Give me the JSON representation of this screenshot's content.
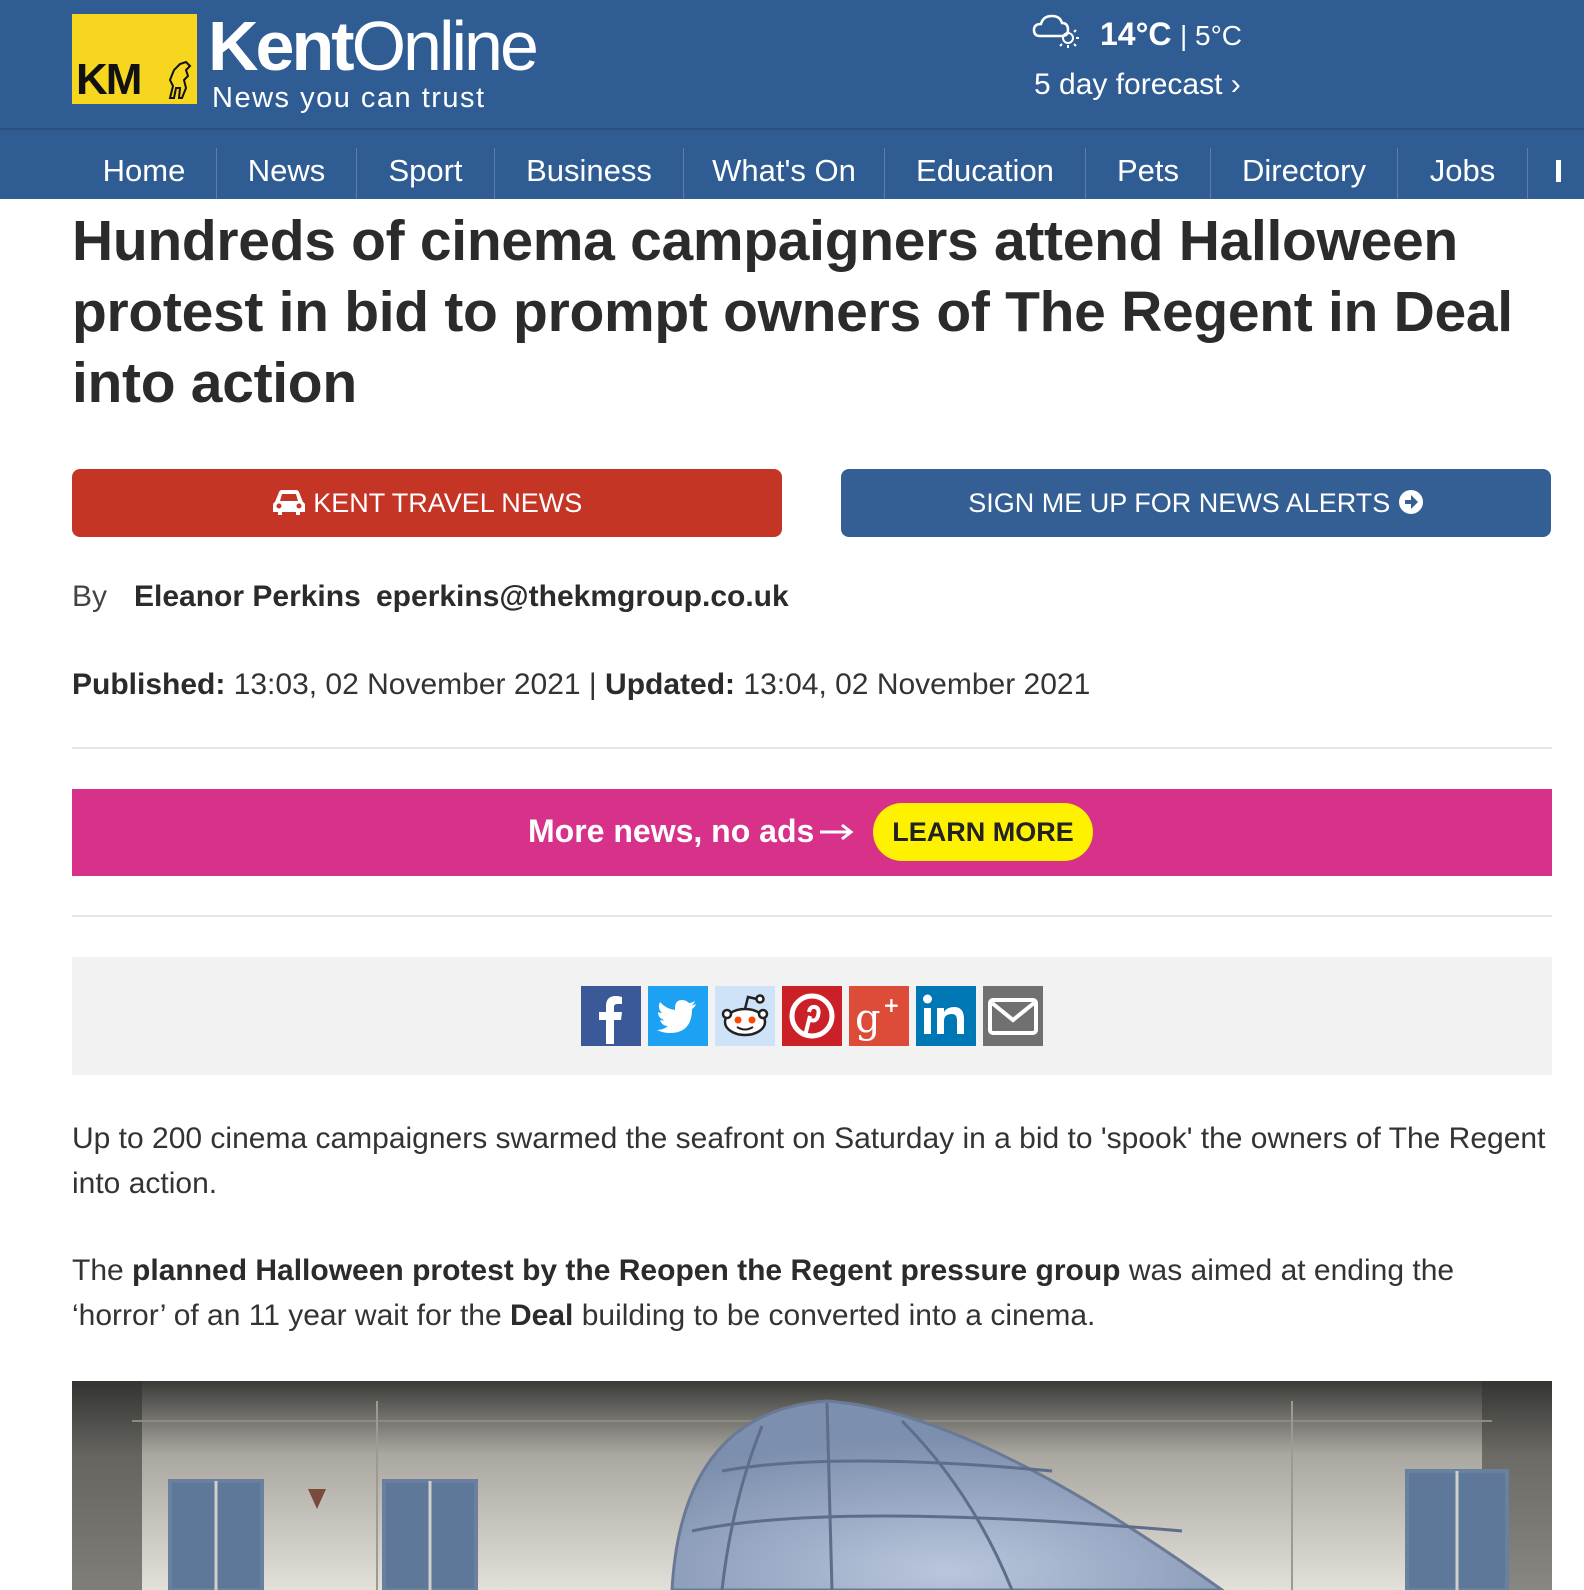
{
  "header": {
    "logo_badge": "KM",
    "brand_bold": "Kent",
    "brand_light": "Online",
    "tagline": "News you can trust",
    "weather": {
      "icon": "cloud-sun-icon",
      "high": "14°C",
      "separator": "|",
      "low": "5°C",
      "forecast_link": "5 day forecast ›"
    }
  },
  "nav": {
    "items": [
      "Home",
      "News",
      "Sport",
      "Business",
      "What's On",
      "Education",
      "Pets",
      "Directory",
      "Jobs"
    ]
  },
  "article": {
    "headline": "Hundreds of cinema campaigners attend Halloween protest in bid to prompt owners of The Regent in Deal into action",
    "travel_button": "KENT TRAVEL NEWS",
    "alerts_button": "SIGN ME UP FOR NEWS ALERTS",
    "byline": {
      "by": "By",
      "author": "Eleanor Perkins",
      "email": "eperkins@thekmgroup.co.uk"
    },
    "dates": {
      "published_label": "Published:",
      "published_value": " 13:03, 02 November 2021 | ",
      "updated_label": "Updated:",
      "updated_value": " 13:04, 02 November 2021"
    },
    "promo": {
      "text": "More news, no ads",
      "button": "LEARN MORE"
    },
    "share_icons": [
      "facebook-icon",
      "twitter-icon",
      "reddit-icon",
      "pinterest-icon",
      "google-plus-icon",
      "linkedin-icon",
      "email-icon"
    ],
    "paragraph1": "Up to 200 cinema campaigners swarmed the seafront on Saturday in a bid to 'spook' the owners of The Regent into action.",
    "paragraph2": {
      "part1": "The ",
      "bold1": "planned Halloween protest by the Reopen the Regent pressure group",
      "part2": " was aimed at ending the ‘horror’ of an 11 year wait for the ",
      "bold2": "Deal",
      "part3": " building to be converted into a cinema."
    }
  },
  "colors": {
    "header_blue": "#2f5d93",
    "logo_yellow": "#f6d61e",
    "travel_red": "#c53526",
    "alerts_blue": "#335f94",
    "promo_pink": "#d7318a",
    "learn_yellow": "#fff200"
  }
}
